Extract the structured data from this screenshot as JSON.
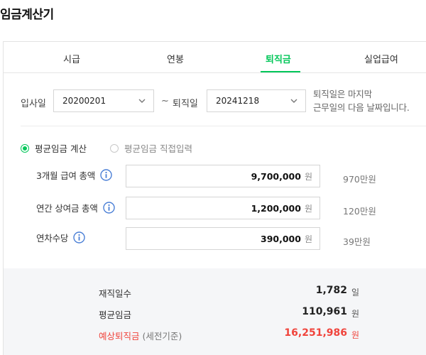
{
  "app": {
    "title": "임금계산기"
  },
  "tabs": [
    {
      "label": "시급",
      "active": false
    },
    {
      "label": "연봉",
      "active": false
    },
    {
      "label": "퇴직금",
      "active": true
    },
    {
      "label": "실업급여",
      "active": false
    }
  ],
  "dates": {
    "start_label": "입사일",
    "start_value": "20200201",
    "separator": "~",
    "end_label": "퇴직일",
    "end_value": "20241218",
    "note_line1": "퇴직일은 마지막",
    "note_line2": "근무일의 다음 날짜입니다."
  },
  "mode": {
    "option1": "평균임금 계산",
    "option2": "평균임금 직접입력",
    "selected": "option1"
  },
  "fields": [
    {
      "label": "3개월 급여 총액",
      "value": "9,700,000",
      "unit": "원",
      "hint": "970만원"
    },
    {
      "label": "연간 상여금 총액",
      "value": "1,200,000",
      "unit": "원",
      "hint": "120만원"
    },
    {
      "label": "연차수당",
      "value": "390,000",
      "unit": "원",
      "hint": "39만원"
    }
  ],
  "results": {
    "days_label": "재직일수",
    "days_value": "1,782",
    "days_unit": "일",
    "avg_label": "평균임금",
    "avg_value": "110,961",
    "avg_unit": "원",
    "severance_label": "예상퇴직금",
    "severance_sub": "(세전기준)",
    "severance_value": "16,251,986",
    "severance_unit": "원"
  },
  "colors": {
    "accent": "#03c75a",
    "highlight": "#f0443c"
  },
  "icons": {
    "info": "info-circle-icon",
    "select": "chevron-down-icon"
  }
}
